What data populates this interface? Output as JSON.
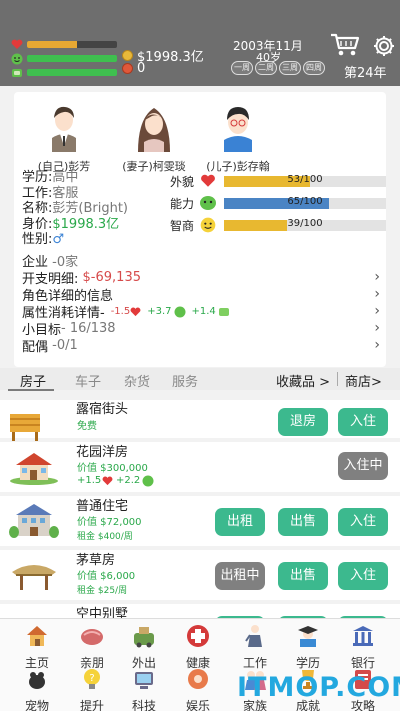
{
  "topbar": {
    "money": "$1998.3亿",
    "tickets": "0",
    "date": "2003年11月",
    "age": "40岁",
    "weeks": [
      "一周",
      "二周",
      "三周",
      "四周"
    ],
    "year": "第24年",
    "health_progress": 0.55,
    "happy_progress": 1.0,
    "energy_progress": 1.0,
    "colors": {
      "health": "#e8a833",
      "happy": "#3fbf4f",
      "energy": "#3fbf4f"
    }
  },
  "profile": {
    "avatars": [
      {
        "label": "(自己)彭芳"
      },
      {
        "label": "(妻子)柯雯琰"
      },
      {
        "label": "(儿子)彭存翰"
      }
    ],
    "info": {
      "education_label": "学历:",
      "education": "高中",
      "job_label": "工作:",
      "job": "客服",
      "name_label": "名称:",
      "name": "彭芳(Bright)",
      "worth_label": "身价:",
      "worth": "$1998.3亿",
      "gender_label": "性别:",
      "gender": "♂"
    },
    "traits": [
      {
        "label": "外貌",
        "value": "53/100",
        "progress": 0.53,
        "color": "#e8b830"
      },
      {
        "label": "能力",
        "value": "65/100",
        "progress": 0.65,
        "color": "#4a84c4"
      },
      {
        "label": "智商",
        "value": "39/100",
        "progress": 0.39,
        "color": "#e8b830"
      }
    ],
    "links": {
      "company_label": "企业",
      "company": "-0家",
      "expense_label": "开支明细:",
      "expense": "$-69,135",
      "role_detail": "角色详细的信息",
      "consume_label": "属性消耗详情-",
      "consume_health": "-1.5",
      "consume_happy": "+3.7",
      "consume_energy": "+1.4",
      "goal_label": "小目标",
      "goal": "- 16/138",
      "spouse_label": "配偶",
      "spouse": "-0/1"
    }
  },
  "tabs": {
    "items": [
      "房子",
      "车子",
      "杂货",
      "服务"
    ],
    "collection": "收藏品 >",
    "shop": "商店>"
  },
  "list": [
    {
      "name": "露宿街头",
      "price": "免费",
      "sub": "",
      "buttons": [
        "退房",
        "入住"
      ]
    },
    {
      "name": "花园洋房",
      "price": "价值 $300,000",
      "sub": "",
      "extra_health": "+1.5",
      "extra_happy": "+2.2",
      "buttons": [
        "入住中"
      ]
    },
    {
      "name": "普通住宅",
      "price": "价值 $72,000",
      "sub": "租金 $400/周",
      "buttons": [
        "出租",
        "出售",
        "入住"
      ]
    },
    {
      "name": "茅草房",
      "price": "价值 $6,000",
      "sub": "租金 $25/周",
      "buttons": [
        "出租中",
        "出售",
        "入住"
      ]
    },
    {
      "name": "空中别墅",
      "price": "",
      "sub": "",
      "buttons": []
    }
  ],
  "nav": {
    "row1": [
      "主页",
      "亲朋",
      "外出",
      "健康",
      "工作",
      "学历",
      "银行"
    ],
    "row2": [
      "宠物",
      "提升",
      "科技",
      "娱乐",
      "家族",
      "成就",
      "攻略"
    ]
  },
  "watermark": {
    "text": "ITMOP.COM"
  }
}
